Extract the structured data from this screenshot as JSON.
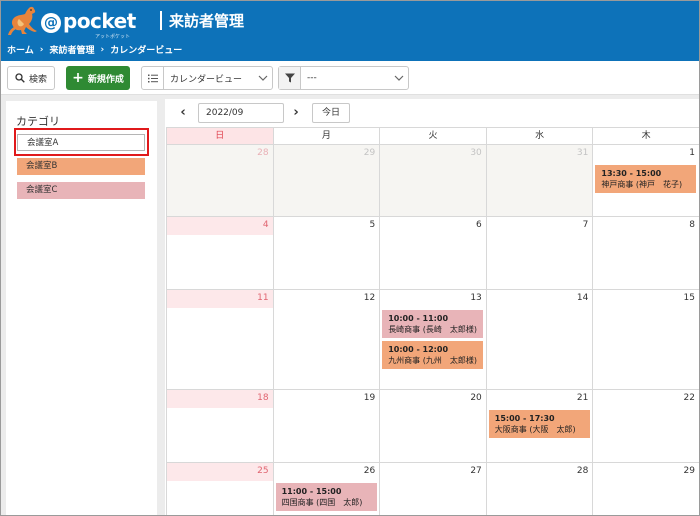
{
  "header": {
    "logo_text": "pocket",
    "logo_at": "@",
    "logo_sub": "アットポケット",
    "title": "来訪者管理",
    "breadcrumb": [
      "ホーム",
      "来訪者管理",
      "カレンダービュー"
    ]
  },
  "toolbar": {
    "search_label": "検索",
    "new_label": "新規作成",
    "view_select": "カレンダービュー",
    "filter_select": "---"
  },
  "sidebar": {
    "title": "カテゴリ",
    "categories": [
      {
        "label": "会議室A",
        "color": "#ffffff"
      },
      {
        "label": "会議室B",
        "color": "#f2a679"
      },
      {
        "label": "会議室C",
        "color": "#e8b4b8"
      }
    ]
  },
  "calendar": {
    "month": "2022/09",
    "today_label": "今日",
    "weekdays": [
      "日",
      "月",
      "火",
      "水",
      "木"
    ],
    "weeks": [
      {
        "days": [
          "28",
          "29",
          "30",
          "31",
          "1"
        ]
      },
      {
        "days": [
          "4",
          "5",
          "6",
          "7",
          "8"
        ]
      },
      {
        "days": [
          "11",
          "12",
          "13",
          "14",
          "15"
        ]
      },
      {
        "days": [
          "18",
          "19",
          "20",
          "21",
          "22"
        ]
      },
      {
        "days": [
          "25",
          "26",
          "27",
          "28",
          "29"
        ]
      }
    ],
    "events": [
      {
        "time": "13:30 - 15:00",
        "title": "神戸商事 (神戸　花子)",
        "color": "#f2a679"
      },
      {
        "time": "10:00 - 11:00",
        "title": "長崎商事 (長崎　太郎様)",
        "color": "#e8b4b8"
      },
      {
        "time": "10:00 - 12:00",
        "title": "九州商事 (九州　太郎様)",
        "color": "#f2a679"
      },
      {
        "time": "15:00 - 17:30",
        "title": "大阪商事 (大阪　太郎)",
        "color": "#f2a679"
      },
      {
        "time": "11:00 - 15:00",
        "title": "四国商事 (四国　太郎)",
        "color": "#e8b4b8"
      }
    ]
  }
}
